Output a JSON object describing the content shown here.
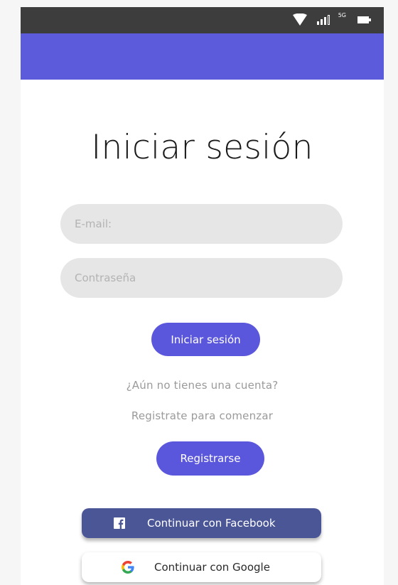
{
  "status_bar": {
    "network_type": "5G",
    "icons": [
      "wifi-icon",
      "signal-icon",
      "battery-icon"
    ]
  },
  "login": {
    "title": "Iniciar sesión",
    "email_placeholder": "E-mail:",
    "email_value": "",
    "password_placeholder": "Contraseña",
    "password_value": "",
    "submit_label": "Iniciar sesión"
  },
  "signup": {
    "prompt": "¿Aún no tienes una cuenta?",
    "cta_text": "Registrate para comenzar",
    "button_label": "Registrarse"
  },
  "social": {
    "facebook_label": "Continuar con Facebook",
    "google_label": "Continuar con Google"
  },
  "colors": {
    "accent": "#5b5bdc",
    "status_bar": "#3d3d3d",
    "facebook": "#4b5697",
    "field_bg": "#e6e6e6"
  }
}
